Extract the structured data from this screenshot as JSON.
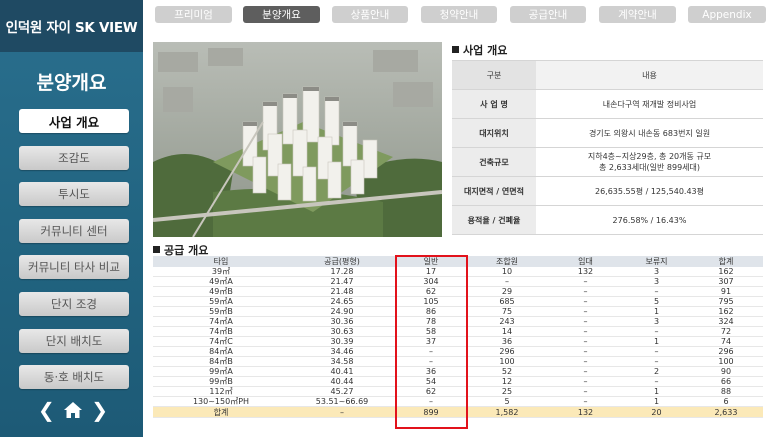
{
  "sidebar": {
    "site_title": "인덕원 자이 SK VIEW",
    "section_title": "분양개요",
    "menu": [
      "사업 개요",
      "조감도",
      "투시도",
      "커뮤니티 센터",
      "커뮤니티 타사 비교",
      "단지 조경",
      "단지 배치도",
      "동·호 배치도"
    ],
    "active_index": 0,
    "nav": {
      "prev": "‹",
      "next": "›",
      "home_icon": "home-icon"
    }
  },
  "tabs": [
    "프리미엄",
    "분양개요",
    "상품안내",
    "청약안내",
    "공급안내",
    "계약안내",
    "Appendix"
  ],
  "active_tab": 1,
  "overview": {
    "heading": "사업 개요",
    "header": [
      "구분",
      "내용"
    ],
    "rows": [
      {
        "label": "사 업 명",
        "value": "내손다구역 재개발 정비사업"
      },
      {
        "label": "대지위치",
        "value": "경기도 의왕시 내손동 683번지 일원"
      },
      {
        "label": "건축규모",
        "value": "지하4층~지상29층, 총 20개동 규모",
        "value2": "총 2,633세대(일반 899세대)"
      },
      {
        "label": "대지면적 / 연면적",
        "value": "26,635.55평 / 125,540.43평"
      },
      {
        "label": "용적율 / 건폐율",
        "value": "276.58% / 16.43%"
      }
    ]
  },
  "supply": {
    "heading": "공급 개요",
    "columns": [
      "타입",
      "공급(평형)",
      "일반",
      "조합원",
      "임대",
      "보류지",
      "합계"
    ],
    "rows": [
      [
        "39㎡",
        "17.28",
        "17",
        "10",
        "132",
        "3",
        "162"
      ],
      [
        "49㎡A",
        "21.47",
        "304",
        "–",
        "–",
        "3",
        "307"
      ],
      [
        "49㎡B",
        "21.48",
        "62",
        "29",
        "–",
        "–",
        "91"
      ],
      [
        "59㎡A",
        "24.65",
        "105",
        "685",
        "–",
        "5",
        "795"
      ],
      [
        "59㎡B",
        "24.90",
        "86",
        "75",
        "–",
        "1",
        "162"
      ],
      [
        "74㎡A",
        "30.36",
        "78",
        "243",
        "–",
        "3",
        "324"
      ],
      [
        "74㎡B",
        "30.63",
        "58",
        "14",
        "–",
        "–",
        "72"
      ],
      [
        "74㎡C",
        "30.39",
        "37",
        "36",
        "–",
        "1",
        "74"
      ],
      [
        "84㎡A",
        "34.46",
        "–",
        "296",
        "–",
        "–",
        "296"
      ],
      [
        "84㎡B",
        "34.58",
        "–",
        "100",
        "–",
        "–",
        "100"
      ],
      [
        "99㎡A",
        "40.41",
        "36",
        "52",
        "–",
        "2",
        "90"
      ],
      [
        "99㎡B",
        "40.44",
        "54",
        "12",
        "–",
        "–",
        "66"
      ],
      [
        "112㎡",
        "45.27",
        "62",
        "25",
        "–",
        "1",
        "88"
      ],
      [
        "130~150㎡PH",
        "53.51~66.69",
        "–",
        "5",
        "–",
        "1",
        "6"
      ]
    ],
    "total": [
      "합계",
      "–",
      "899",
      "1,582",
      "132",
      "20",
      "2,633"
    ]
  }
}
